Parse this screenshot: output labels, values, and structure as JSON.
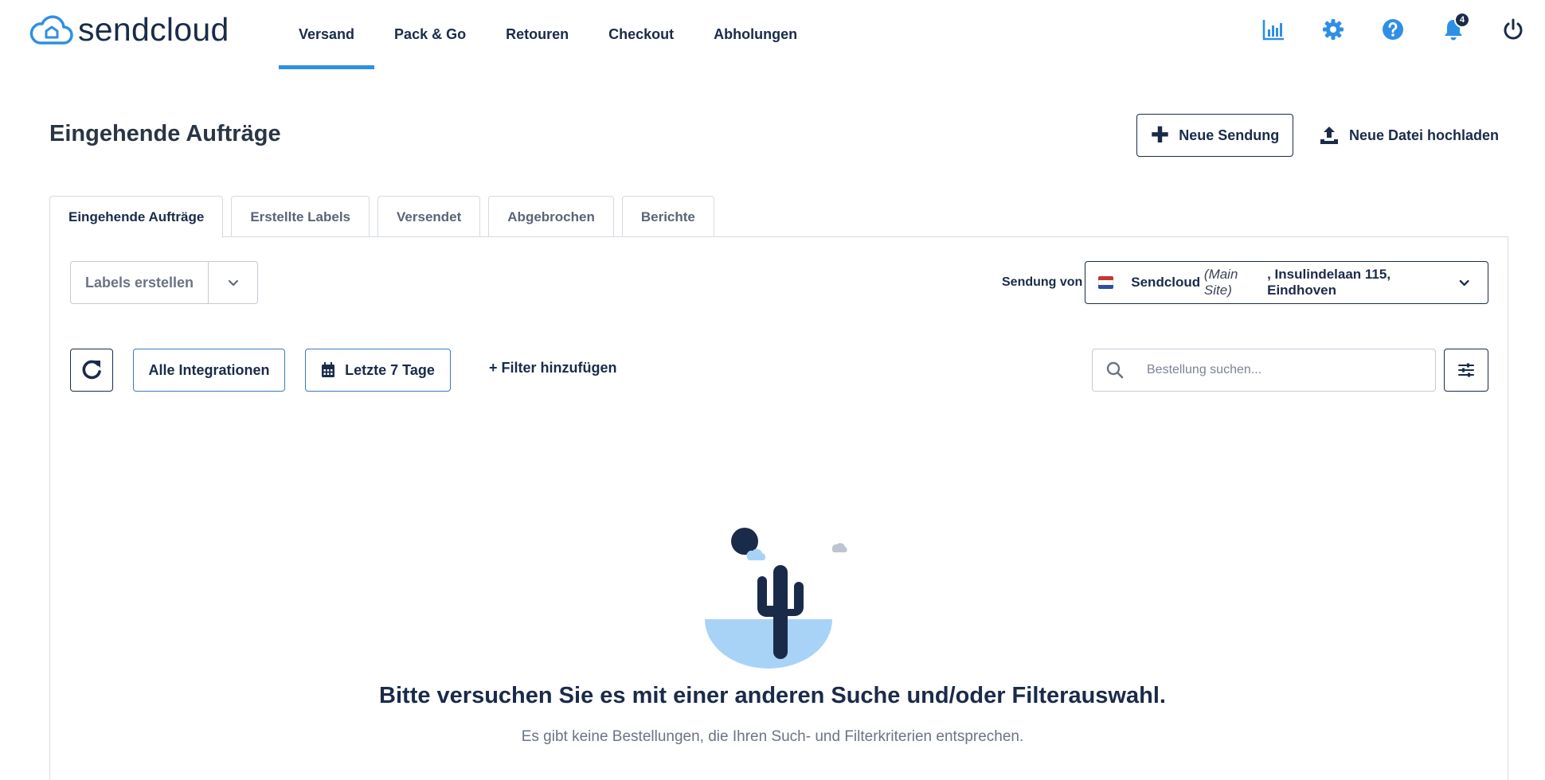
{
  "brand": {
    "name": "sendcloud",
    "accent": "#2f8fe6",
    "navy": "#1a2b4a"
  },
  "nav": {
    "items": [
      {
        "label": "Versand",
        "active": true
      },
      {
        "label": "Pack & Go"
      },
      {
        "label": "Retouren"
      },
      {
        "label": "Checkout"
      },
      {
        "label": "Abholungen"
      }
    ],
    "icons": [
      "analytics-icon",
      "gear-icon",
      "help-icon",
      "bell-icon",
      "power-icon"
    ],
    "notification_count": "4"
  },
  "header": {
    "title": "Eingehende Aufträge",
    "new_shipment_label": "Neue Sendung",
    "upload_label": "Neue Datei hochladen"
  },
  "tabs": [
    {
      "label": "Eingehende Aufträge",
      "active": true
    },
    {
      "label": "Erstellte Labels"
    },
    {
      "label": "Versendet"
    },
    {
      "label": "Abgebrochen"
    },
    {
      "label": "Berichte"
    }
  ],
  "toolbar": {
    "create_labels_label": "Labels erstellen",
    "ship_from_label": "Sendung von",
    "ship_from_name": "Sendcloud",
    "ship_from_site": "(Main Site)",
    "ship_from_address": ", Insulindelaan 115, Eindhoven",
    "integrations_label": "Alle Integrationen",
    "date_range_label": "Letzte 7 Tage",
    "add_filter_label": "+ Filter hinzufügen",
    "search_placeholder": "Bestellung suchen..."
  },
  "empty_state": {
    "title": "Bitte versuchen Sie es mit einer anderen Suche und/oder Filterauswahl.",
    "subtitle": "Es gibt keine Bestellungen, die Ihren Such- und Filterkriterien entsprechen."
  }
}
